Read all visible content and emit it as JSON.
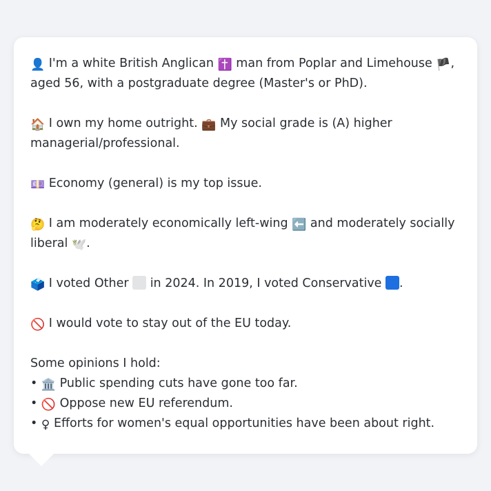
{
  "profile": {
    "intro_icon": "👤",
    "intro_a": "I'm a white British Anglican",
    "religion_icon": "✝️",
    "intro_b": "man from Poplar and Limehouse",
    "flag_icon": "🏴",
    "intro_c": ", aged 56, with a postgraduate degree (Master's or PhD).",
    "home_icon": "🏠",
    "home_text": "I own my home outright.",
    "work_icon": "💼",
    "grade_text": "My social grade is (A) higher managerial/professional.",
    "issue_icon": "💷",
    "issue_text": "Economy (general) is my top issue.",
    "think_icon": "🤔",
    "ideology_a": "I am moderately economically left-wing",
    "left_icon": "⬅️",
    "ideology_b": "and moderately socially liberal",
    "dove_icon": "🕊️",
    "ideology_end": ".",
    "vote_icon": "🗳️",
    "vote_a": "I voted Other",
    "vote_b": "in 2024. In 2019, I voted Conservative",
    "vote_end": ".",
    "other_color": "#e2e4e6",
    "conservative_color": "#1e6fe0",
    "eu_icon": "🚫",
    "eu_text": "I would vote to stay out of the EU today.",
    "opinions_heading": "Some opinions I hold:",
    "bullet": "•",
    "opinions": [
      {
        "icon": "🏛️",
        "text": "Public spending cuts have gone too far."
      },
      {
        "icon": "🚫",
        "text": "Oppose new EU referendum."
      },
      {
        "icon": "♀",
        "text": "Efforts for women's equal opportunities have been about right."
      }
    ]
  }
}
